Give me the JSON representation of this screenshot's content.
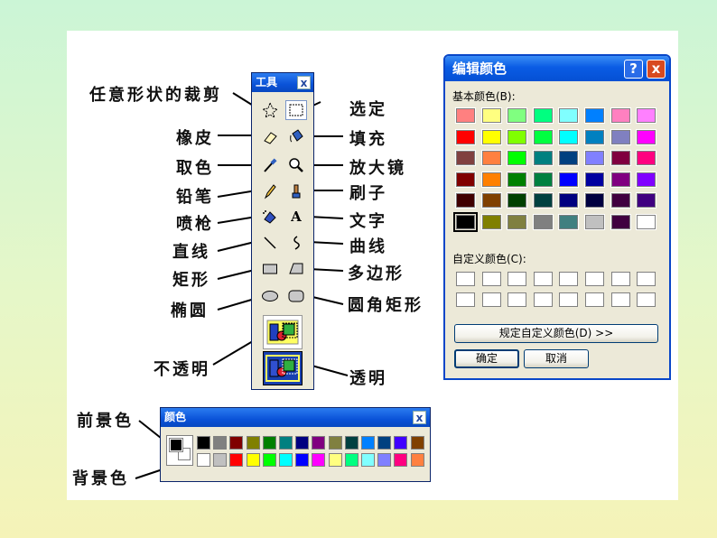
{
  "labels": {
    "free_select": "任意形状的裁剪",
    "select": "选定",
    "eraser": "橡皮",
    "fill": "填充",
    "pick_color": "取色",
    "magnifier": "放大镜",
    "pencil": "铅笔",
    "brush": "刷子",
    "airbrush": "喷枪",
    "text": "文字",
    "line": "直线",
    "curve": "曲线",
    "rectangle": "矩形",
    "polygon": "多边形",
    "ellipse": "椭圆",
    "rounded_rect": "圆角矩形",
    "opaque": "不透明",
    "transparent": "透明",
    "foreground": "前景色",
    "background": "背景色"
  },
  "tools_window": {
    "title": "工具",
    "close": "x",
    "text_tool_glyph": "A"
  },
  "edit_colors_dialog": {
    "title": "编辑颜色",
    "help": "?",
    "close": "x",
    "basic_colors_label": "基本颜色(B):",
    "custom_colors_label": "自定义颜色(C):",
    "define_custom_button": "规定自定义颜色(D) >>",
    "ok_button": "确定",
    "cancel_button": "取消",
    "basic_colors": [
      [
        "#ff8080",
        "#ffff80",
        "#80ff80",
        "#00ff80",
        "#80ffff",
        "#0080ff",
        "#ff80c0",
        "#ff80ff"
      ],
      [
        "#ff0000",
        "#ffff00",
        "#80ff00",
        "#00ff40",
        "#00ffff",
        "#0080c0",
        "#8080c0",
        "#ff00ff"
      ],
      [
        "#804040",
        "#ff8040",
        "#00ff00",
        "#008080",
        "#004080",
        "#8080ff",
        "#800040",
        "#ff0080"
      ],
      [
        "#800000",
        "#ff8000",
        "#008000",
        "#008040",
        "#0000ff",
        "#0000a0",
        "#800080",
        "#8000ff"
      ],
      [
        "#400000",
        "#804000",
        "#004000",
        "#004040",
        "#000080",
        "#000040",
        "#400040",
        "#400080"
      ],
      [
        "#000000",
        "#808000",
        "#808040",
        "#808080",
        "#408080",
        "#c0c0c0",
        "#400040",
        "#ffffff"
      ]
    ],
    "selected_index": [
      5,
      0
    ]
  },
  "palette": {
    "title": "颜色",
    "close": "x",
    "foreground_color": "#000000",
    "background_color": "#ffffff",
    "top_row": [
      "#000000",
      "#808080",
      "#800000",
      "#808000",
      "#008000",
      "#008080",
      "#000080",
      "#800080",
      "#808040",
      "#004040",
      "#0080ff",
      "#004080",
      "#4000ff",
      "#804000"
    ],
    "bottom_row": [
      "#ffffff",
      "#c0c0c0",
      "#ff0000",
      "#ffff00",
      "#00ff00",
      "#00ffff",
      "#0000ff",
      "#ff00ff",
      "#ffff80",
      "#00ff80",
      "#80ffff",
      "#8080ff",
      "#ff0080",
      "#ff8040"
    ]
  }
}
